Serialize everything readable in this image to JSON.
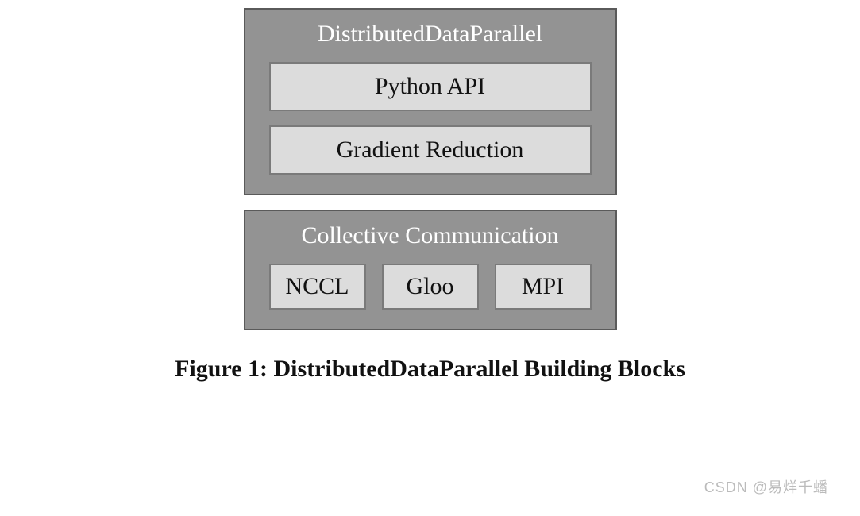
{
  "diagram": {
    "top_block": {
      "title": "DistributedDataParallel",
      "items": [
        "Python API",
        "Gradient Reduction"
      ]
    },
    "bottom_block": {
      "title": "Collective Communication",
      "items": [
        "NCCL",
        "Gloo",
        "MPI"
      ]
    }
  },
  "caption": "Figure 1: DistributedDataParallel Building Blocks",
  "watermark": "CSDN @易烊千蟠"
}
